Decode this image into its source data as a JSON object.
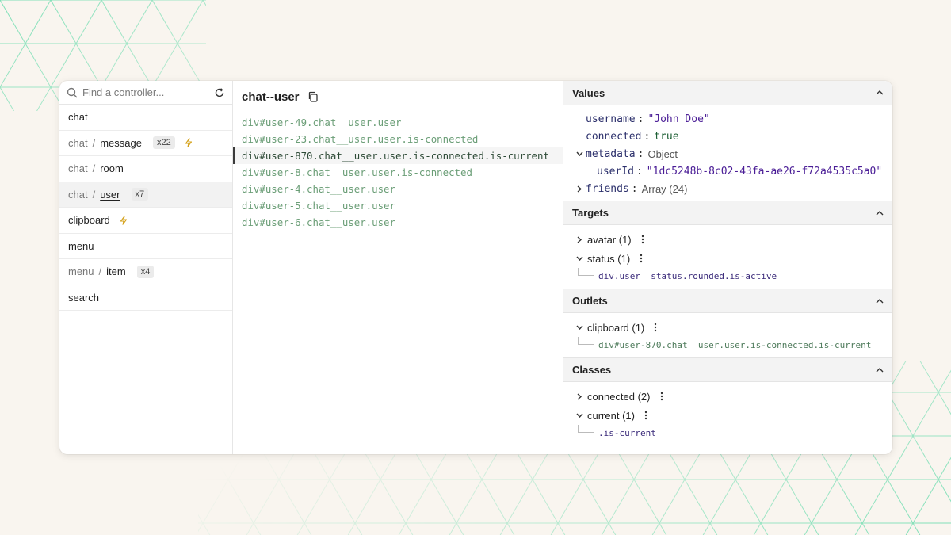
{
  "search": {
    "placeholder": "Find a controller..."
  },
  "controllers": [
    {
      "ns": "",
      "sep": "",
      "name": "chat",
      "badge": "",
      "bolt": false,
      "selected": false
    },
    {
      "ns": "chat",
      "sep": "/",
      "name": "message",
      "badge": "x22",
      "bolt": true,
      "selected": false
    },
    {
      "ns": "chat",
      "sep": "/",
      "name": "room",
      "badge": "",
      "bolt": false,
      "selected": false
    },
    {
      "ns": "chat",
      "sep": "/",
      "name": "user",
      "badge": "x7",
      "bolt": false,
      "selected": true
    },
    {
      "ns": "",
      "sep": "",
      "name": "clipboard",
      "badge": "",
      "bolt": true,
      "selected": false
    },
    {
      "ns": "",
      "sep": "",
      "name": "menu",
      "badge": "",
      "bolt": false,
      "selected": false
    },
    {
      "ns": "menu",
      "sep": "/",
      "name": "item",
      "badge": "x4",
      "bolt": false,
      "selected": false
    },
    {
      "ns": "",
      "sep": "",
      "name": "search",
      "badge": "",
      "bolt": false,
      "selected": false
    }
  ],
  "middle": {
    "title": "chat--user",
    "elements": [
      {
        "text": "div#user-49.chat__user.user",
        "current": false
      },
      {
        "text": "div#user-23.chat__user.user.is-connected",
        "current": false
      },
      {
        "text": "div#user-870.chat__user.user.is-connected.is-current",
        "current": true
      },
      {
        "text": "div#user-8.chat__user.user.is-connected",
        "current": false
      },
      {
        "text": "div#user-4.chat__user.user",
        "current": false
      },
      {
        "text": "div#user-5.chat__user.user",
        "current": false
      },
      {
        "text": "div#user-6.chat__user.user",
        "current": false
      }
    ]
  },
  "values": {
    "heading": "Values",
    "username_key": "username",
    "username_val": "\"John Doe\"",
    "connected_key": "connected",
    "connected_val": "true",
    "metadata_key": "metadata",
    "metadata_type": "Object",
    "userid_key": "userId",
    "userid_val": "\"1dc5248b-8c02-43fa-ae26-f72a4535c5a0\"",
    "friends_key": "friends",
    "friends_type": "Array (24)",
    "colon": ":"
  },
  "targets": {
    "heading": "Targets",
    "avatar": "avatar (1)",
    "status": "status (1)",
    "status_child": "div.user__status.rounded.is-active"
  },
  "outlets": {
    "heading": "Outlets",
    "clipboard": "clipboard (1)",
    "clipboard_child": "div#user-870.chat__user.user.is-connected.is-current"
  },
  "classes": {
    "heading": "Classes",
    "connected": "connected (2)",
    "current": "current (1)",
    "current_child": ".is-current"
  },
  "colors": {
    "background": "#f9f5ef",
    "pattern": "#6fdcb0",
    "element_text": "#6b9e77",
    "string_value": "#4a1d96",
    "bolt": "#d4a017"
  }
}
